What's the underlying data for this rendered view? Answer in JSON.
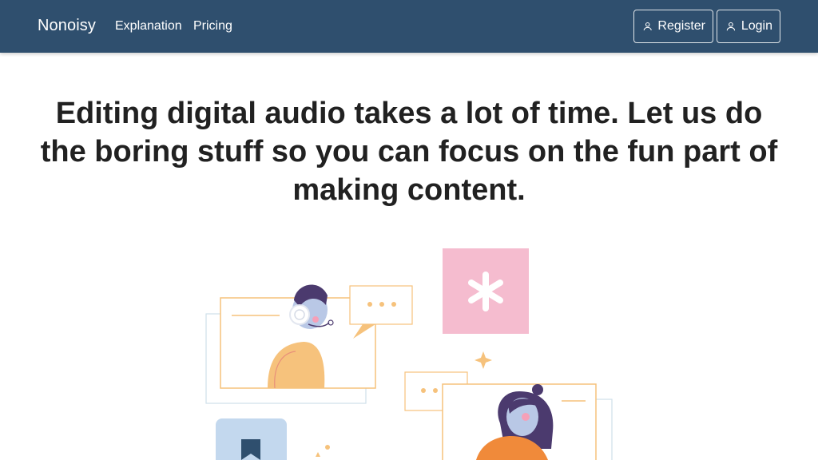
{
  "nav": {
    "brand": "Nonoisy",
    "links": [
      "Explanation",
      "Pricing"
    ],
    "register_label": "Register",
    "login_label": "Login",
    "user_icon": "user-icon"
  },
  "hero": {
    "headline": "Editing digital audio takes a lot of time. Let us do the boring stuff so you can focus on the fun part of making content."
  },
  "colors": {
    "navbar": "#2f4f6e",
    "accent_orange": "#f6c27c",
    "accent_pink": "#f5bccf"
  }
}
